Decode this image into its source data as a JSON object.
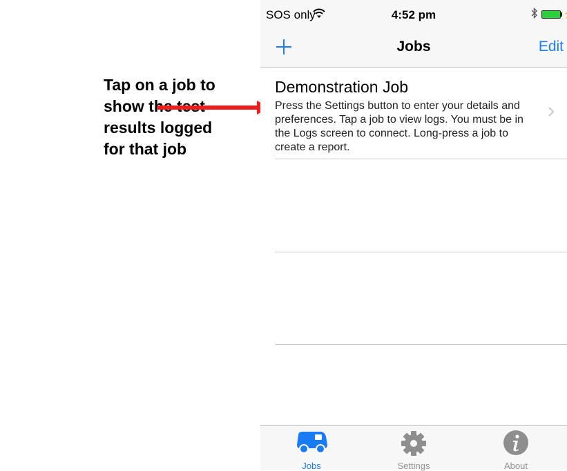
{
  "annotation": {
    "lines": [
      "Tap on a job to",
      "show the test",
      "results logged",
      "for that job"
    ],
    "arrow_color": "#ee1c1c"
  },
  "status_bar": {
    "carrier": "SOS only",
    "time": "4:52 pm",
    "battery_color": "#2ad13a"
  },
  "nav": {
    "title": "Jobs",
    "edit_label": "Edit",
    "accent_color": "#1a7cf5"
  },
  "jobs": [
    {
      "title": "Demonstration Job",
      "description": "Press the Settings button to enter your details and preferences. Tap a job to view logs. You must be in the Logs screen to connect. Long-press a job to create a report."
    }
  ],
  "tabs": [
    {
      "label": "Jobs",
      "icon": "van-icon",
      "active": true
    },
    {
      "label": "Settings",
      "icon": "gear-icon",
      "active": false
    },
    {
      "label": "About",
      "icon": "info-icon",
      "active": false
    }
  ]
}
